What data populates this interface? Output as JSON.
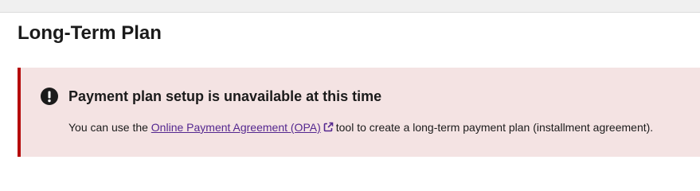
{
  "page": {
    "title": "Long-Term Plan"
  },
  "alert": {
    "type": "error",
    "icon": "error-exclamation-icon",
    "heading": "Payment plan setup is unavailable at this time",
    "body_prefix": "You can use the ",
    "link_text": "Online Payment Agreement (OPA)",
    "link_icon": "external-link-icon",
    "body_suffix": "tool to create a long-term payment plan (installment agreement).",
    "accent_color": "#b50909",
    "background_color": "#f4e3e3",
    "link_color": "#54278f"
  }
}
